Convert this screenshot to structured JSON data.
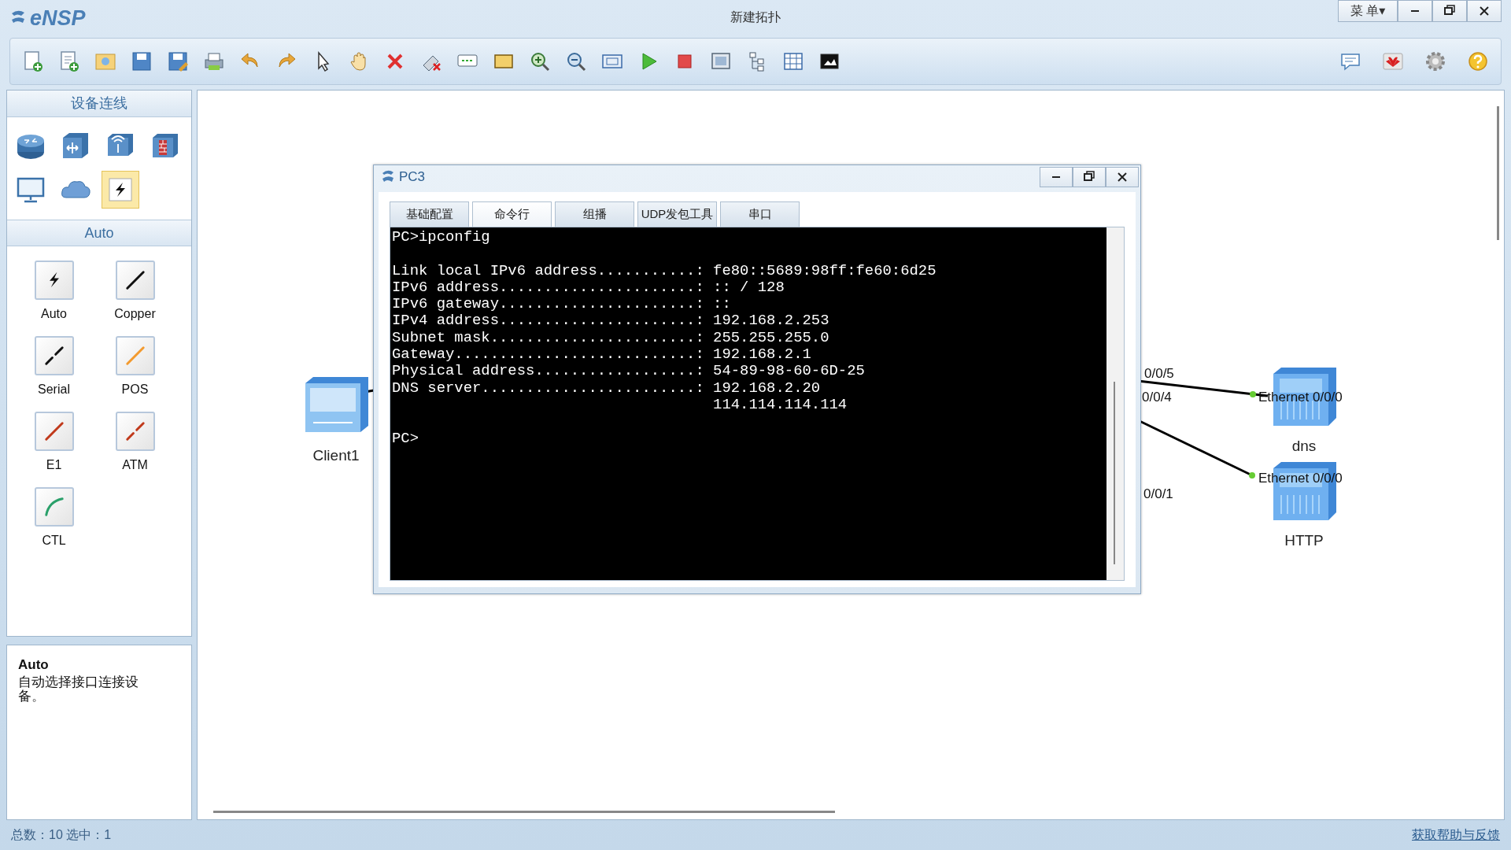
{
  "app": {
    "logo": "eNSP",
    "title": "新建拓扑",
    "menu_button": "菜 单▾"
  },
  "sidebar": {
    "devices_header": "设备连线",
    "devices": [
      {
        "kind": "router",
        "selected": false
      },
      {
        "kind": "switch",
        "selected": false
      },
      {
        "kind": "wireless",
        "selected": false
      },
      {
        "kind": "firewall",
        "selected": false
      },
      {
        "kind": "pc",
        "selected": false
      },
      {
        "kind": "cloud",
        "selected": false
      },
      {
        "kind": "link",
        "selected": true
      }
    ],
    "links_header": "Auto",
    "links": [
      {
        "label": "Auto",
        "kind": "auto"
      },
      {
        "label": "Copper",
        "kind": "copper"
      },
      {
        "label": "Serial",
        "kind": "serial"
      },
      {
        "label": "POS",
        "kind": "pos"
      },
      {
        "label": "E1",
        "kind": "e1"
      },
      {
        "label": "ATM",
        "kind": "atm"
      },
      {
        "label": "CTL",
        "kind": "ctl"
      }
    ],
    "info": {
      "title": "Auto",
      "text": "自动选择接口连接设备。"
    }
  },
  "canvas": {
    "nodes": [
      {
        "label": "Client1",
        "kind": "client"
      },
      {
        "label": "dns",
        "kind": "server"
      },
      {
        "label": "HTTP",
        "kind": "server"
      }
    ],
    "port_labels": [
      "0/0/5",
      "0/0/4",
      "Ethernet 0/0/0",
      "Ethernet 0/0/0",
      "0/0/1"
    ]
  },
  "console_window": {
    "title": "PC3",
    "tabs": [
      {
        "label": "基础配置",
        "selected": false
      },
      {
        "label": "命令行",
        "selected": true
      },
      {
        "label": "组播",
        "selected": false
      },
      {
        "label": "UDP发包工具",
        "selected": false
      },
      {
        "label": "串口",
        "selected": false
      }
    ],
    "output": "PC>ipconfig\n\nLink local IPv6 address...........: fe80::5689:98ff:fe60:6d25\nIPv6 address......................: :: / 128\nIPv6 gateway......................: ::\nIPv4 address......................: 192.168.2.253\nSubnet mask.......................: 255.255.255.0\nGateway...........................: 192.168.2.1\nPhysical address..................: 54-89-98-60-6D-25\nDNS server........................: 192.168.2.20\n                                    114.114.114.114\n\nPC>"
  },
  "status_bar": {
    "summary": "总数：10 选中：1",
    "help_link": "获取帮助与反馈"
  }
}
